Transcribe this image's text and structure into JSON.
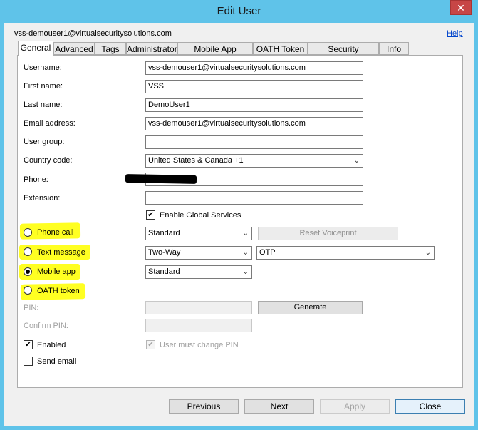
{
  "window": {
    "title": "Edit User",
    "close_glyph": "✕"
  },
  "header": {
    "user_email": "vss-demouser1@virtualsecuritysolutions.com",
    "help_label": "Help"
  },
  "tabs": [
    {
      "label": "General",
      "active": true
    },
    {
      "label": "Advanced"
    },
    {
      "label": "Tags"
    },
    {
      "label": "Administrator"
    },
    {
      "label": "Mobile App Devices"
    },
    {
      "label": "OATH Token"
    },
    {
      "label": "Security Questions"
    },
    {
      "label": "Info"
    }
  ],
  "form": {
    "username": {
      "label": "Username:",
      "value": "vss-demouser1@virtualsecuritysolutions.com"
    },
    "first_name": {
      "label": "First name:",
      "value": "VSS"
    },
    "last_name": {
      "label": "Last name:",
      "value": "DemoUser1"
    },
    "email": {
      "label": "Email address:",
      "value": "vss-demouser1@virtualsecuritysolutions.com"
    },
    "user_group": {
      "label": "User group:",
      "value": ""
    },
    "country_code": {
      "label": "Country code:",
      "value": "United States & Canada +1"
    },
    "phone": {
      "label": "Phone:",
      "value": ""
    },
    "extension": {
      "label": "Extension:",
      "value": ""
    },
    "global_services": {
      "label": "Enable Global Services",
      "checked": true
    }
  },
  "methods": {
    "phone_call": {
      "label": "Phone call",
      "selected": false,
      "mode": "Standard",
      "reset_label": "Reset Voiceprint"
    },
    "text_message": {
      "label": "Text message",
      "selected": false,
      "mode": "Two-Way",
      "otp": "OTP"
    },
    "mobile_app": {
      "label": "Mobile app",
      "selected": true,
      "mode": "Standard"
    },
    "oath_token": {
      "label": "OATH token",
      "selected": false
    }
  },
  "pin": {
    "label": "PIN:",
    "generate_label": "Generate",
    "confirm_label": "Confirm PIN:",
    "must_change_label": "User must change PIN",
    "must_change_checked": true
  },
  "options": {
    "enabled_label": "Enabled",
    "enabled_checked": true,
    "send_email_label": "Send email",
    "send_email_checked": false
  },
  "footer": {
    "previous": "Previous",
    "next": "Next",
    "apply": "Apply",
    "close": "Close"
  },
  "colors": {
    "titlebar": "#5fc3e9",
    "highlight": "#ffff22",
    "close_button": "#c74646"
  }
}
